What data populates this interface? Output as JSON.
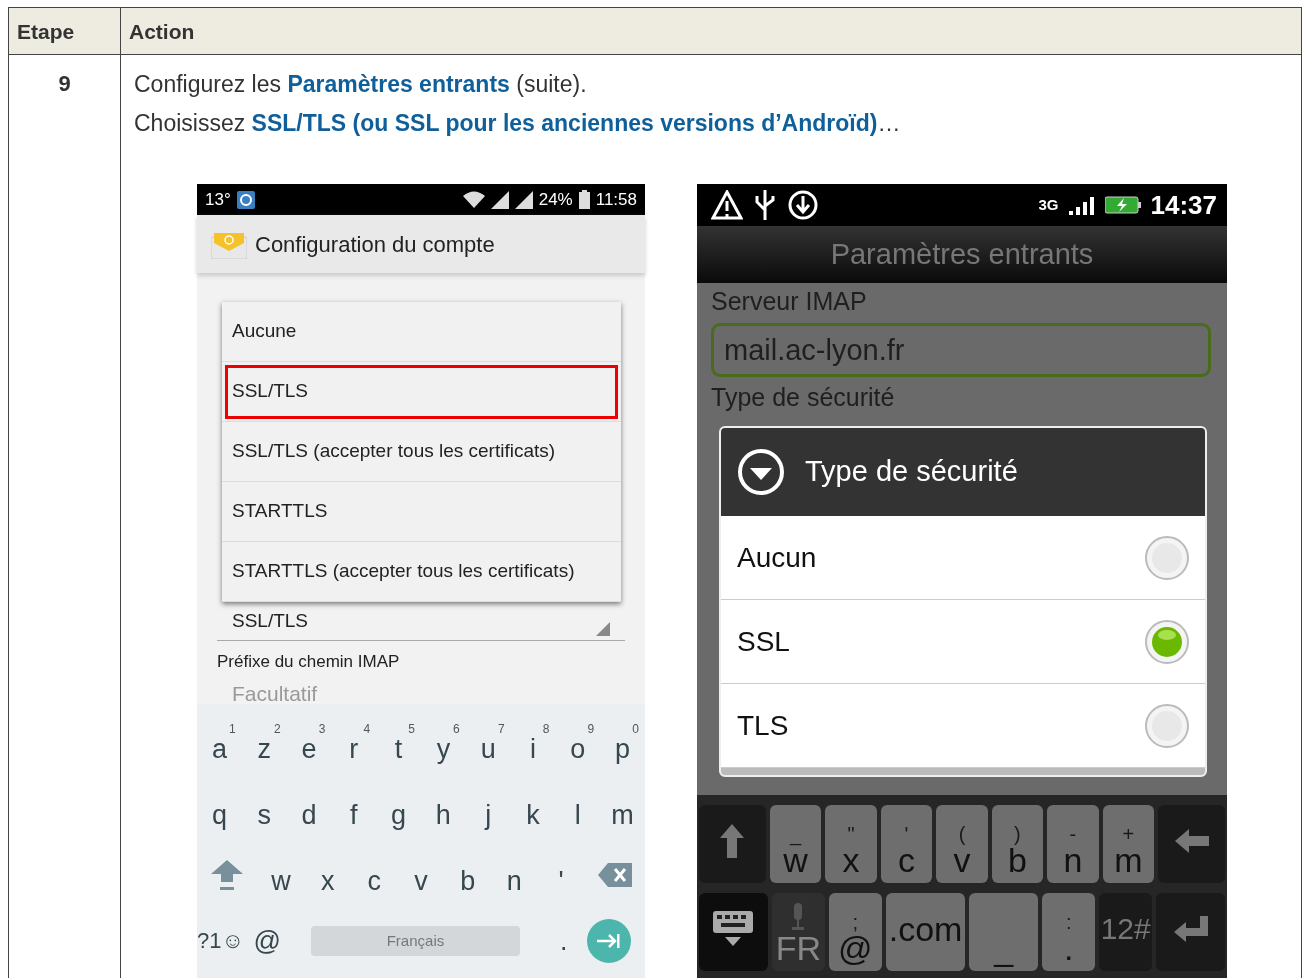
{
  "table": {
    "columns": [
      "Etape",
      "Action"
    ],
    "rows": [
      {
        "step": "9",
        "lines": [
          "Configurez les **Paramètres entrants** (suite).",
          "Choisissez **SSL/TLS (ou SSL pour les anciennes versions d’Androïd)**…"
        ]
      }
    ]
  },
  "left_phone": {
    "status_bar": {
      "temperature": "13°",
      "battery": "24%",
      "time": "11:58"
    },
    "title": "Configuration du compte",
    "menu": [
      {
        "label": "Aucune",
        "selected": false
      },
      {
        "label": "SSL/TLS",
        "selected": true
      },
      {
        "label": "SSL/TLS (accepter tous les certificats)",
        "selected": false
      },
      {
        "label": "STARTTLS",
        "selected": false
      },
      {
        "label": "STARTTLS (accepter tous les certificats)",
        "selected": false
      }
    ],
    "security_value": "SSL/TLS",
    "prefix_label": "Préfixe du chemin IMAP",
    "prefix_placeholder": "Facultatif",
    "keyboard": {
      "rows": [
        [
          {
            "key": "a",
            "hint": "1"
          },
          {
            "key": "z",
            "hint": "2"
          },
          {
            "key": "e",
            "hint": "3"
          },
          {
            "key": "r",
            "hint": "4"
          },
          {
            "key": "t",
            "hint": "5"
          },
          {
            "key": "y",
            "hint": "6"
          },
          {
            "key": "u",
            "hint": "7"
          },
          {
            "key": "i",
            "hint": "8"
          },
          {
            "key": "o",
            "hint": "9"
          },
          {
            "key": "p",
            "hint": "0"
          }
        ],
        [
          {
            "key": "q"
          },
          {
            "key": "s"
          },
          {
            "key": "d"
          },
          {
            "key": "f"
          },
          {
            "key": "g"
          },
          {
            "key": "h"
          },
          {
            "key": "j"
          },
          {
            "key": "k"
          },
          {
            "key": "l"
          },
          {
            "key": "m"
          }
        ],
        [
          {
            "key": "w"
          },
          {
            "key": "x"
          },
          {
            "key": "c"
          },
          {
            "key": "v"
          },
          {
            "key": "b"
          },
          {
            "key": "n"
          },
          {
            "key": "'"
          }
        ]
      ],
      "symbols": "?1☺",
      "at": "@",
      "space": "Français",
      "period": "."
    }
  },
  "right_phone": {
    "status_bar": {
      "network": "3G",
      "time": "14:37"
    },
    "title": "Paramètres entrants",
    "server_label": "Serveur IMAP",
    "server_value": "mail.ac-lyon.fr",
    "security_label": "Type de sécurité",
    "dialog": {
      "title": "Type de sécurité",
      "options": [
        {
          "label": "Aucun",
          "selected": false
        },
        {
          "label": "SSL",
          "selected": true
        },
        {
          "label": "TLS",
          "selected": false
        }
      ]
    },
    "keyboard": {
      "letters": [
        {
          "key": "w",
          "hint": "_"
        },
        {
          "key": "x",
          "hint": "\""
        },
        {
          "key": "c",
          "hint": "'"
        },
        {
          "key": "v",
          "hint": "("
        },
        {
          "key": "b",
          "hint": ")"
        },
        {
          "key": "n",
          "hint": "-"
        },
        {
          "key": "m",
          "hint": "+"
        }
      ],
      "language": "FR",
      "at": {
        "key": "@",
        "hint": ";"
      },
      "dotcom": ".com",
      "underscore": "_",
      "period": {
        "key": ".",
        "hint": ":"
      },
      "numbers": "12#"
    }
  }
}
